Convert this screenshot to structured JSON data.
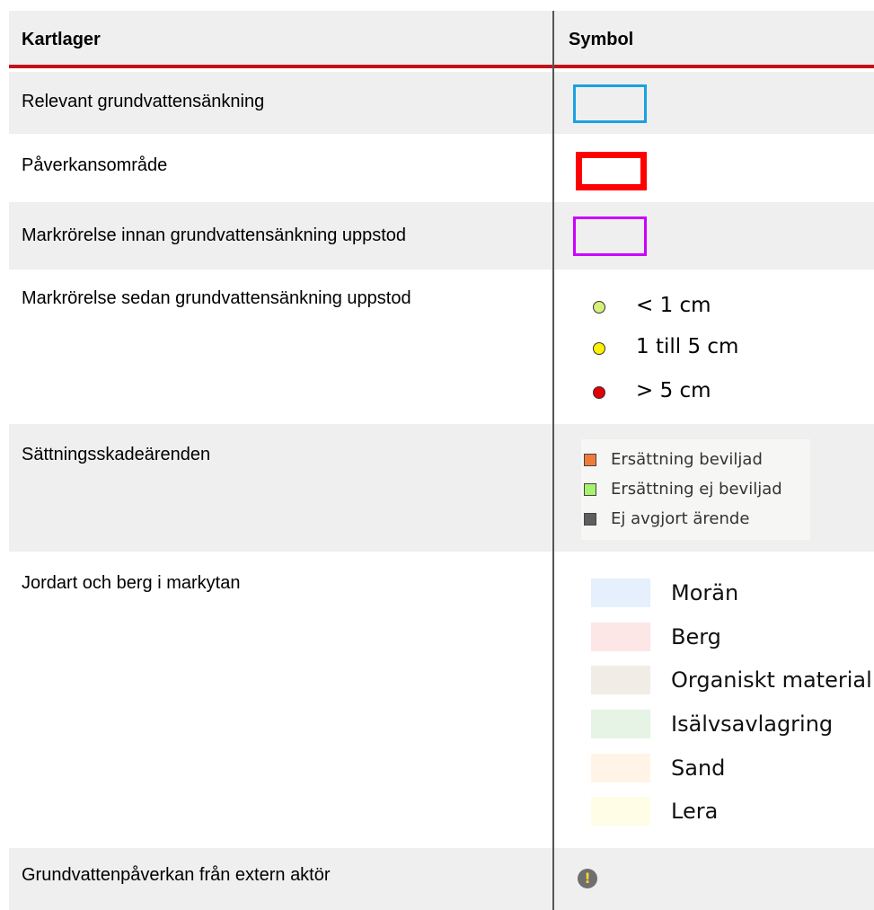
{
  "table": {
    "headers": {
      "layer": "Kartlager",
      "symbol": "Symbol"
    },
    "rows": [
      {
        "label": "Relevant grundvattensänkning",
        "symbol_color": "#1ba1e2"
      },
      {
        "label": "Påverkansområde",
        "symbol_color": "#ff0000"
      },
      {
        "label": "Markrörelse innan grundvattensänkning uppstod",
        "symbol_color": "#cc00ff"
      },
      {
        "label": "Markrörelse sedan grundvattensänkning uppstod",
        "dots": [
          {
            "color": "#d4f07a",
            "label": "< 1 cm"
          },
          {
            "color": "#fff200",
            "label": "1 till 5 cm"
          },
          {
            "color": "#e30000",
            "label": "> 5 cm"
          }
        ]
      },
      {
        "label": "Sättningsskadeärenden",
        "items": [
          {
            "color": "#f07a3a",
            "label": "Ersättning beviljad"
          },
          {
            "color": "#a6f26e",
            "label": "Ersättning ej beviljad"
          },
          {
            "color": "#5e5e5e",
            "label": "Ej avgjort ärende"
          }
        ]
      },
      {
        "label": "Jordart och berg i markytan",
        "items": [
          {
            "color": "#e5f0fc",
            "label": "Morän"
          },
          {
            "color": "#fde6e6",
            "label": "Berg"
          },
          {
            "color": "#f2ece6",
            "label": "Organiskt material"
          },
          {
            "color": "#e6f4e6",
            "label": "Isälvsavlagring"
          },
          {
            "color": "#fff4e6",
            "label": "Sand"
          },
          {
            "color": "#fffde6",
            "label": "Lera"
          }
        ]
      },
      {
        "label": "Grundvattenpåverkan från extern aktör",
        "icon": "warning-icon",
        "icon_glyph": "!"
      }
    ]
  }
}
